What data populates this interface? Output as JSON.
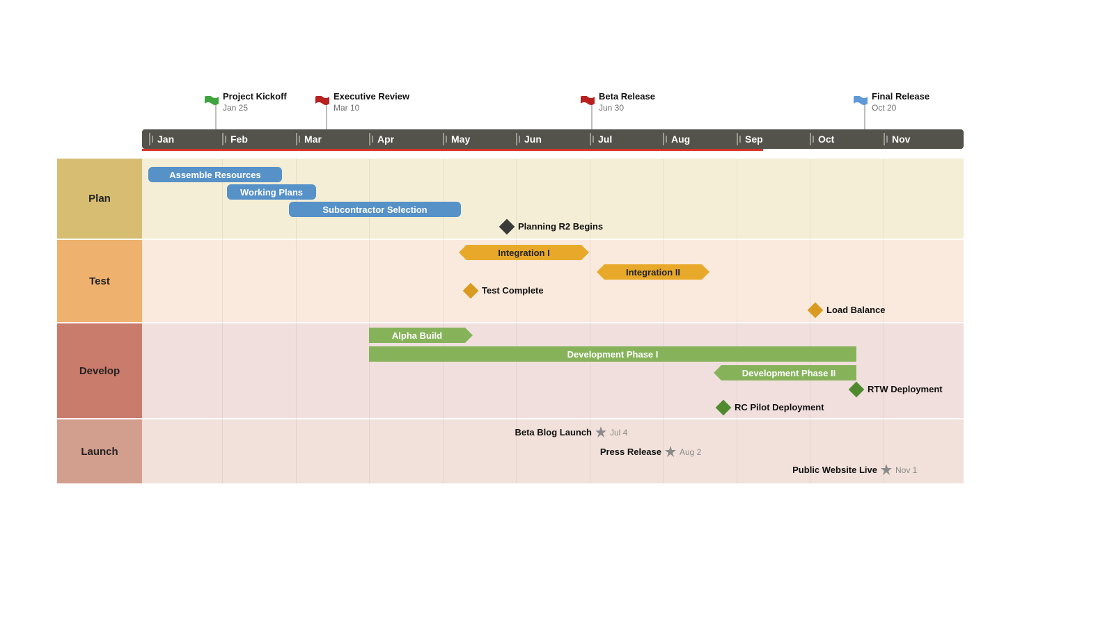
{
  "chart_data": {
    "type": "gantt",
    "title": "",
    "timescale": {
      "months": [
        "Jan",
        "Feb",
        "Mar",
        "Apr",
        "May",
        "Jun",
        "Jul",
        "Aug",
        "Sep",
        "Oct",
        "Nov"
      ],
      "critical_underline_start": "Jan",
      "critical_underline_end": "early Sep"
    },
    "milestones_top": [
      {
        "id": "kickoff",
        "label": "Project Kickoff",
        "date": "Jan 25",
        "flag_color": "#3fa33f"
      },
      {
        "id": "exec",
        "label": "Executive Review",
        "date": "Mar 10",
        "flag_color": "#b8211f"
      },
      {
        "id": "beta",
        "label": "Beta Release",
        "date": "Jun 30",
        "flag_color": "#b8211f"
      },
      {
        "id": "final",
        "label": "Final Release",
        "date": "Oct 20",
        "flag_color": "#5f99d8"
      }
    ],
    "swimlanes": [
      {
        "name": "Plan",
        "label_bg": "#d7bd72",
        "body_bg": "#f5eed6",
        "bars": [
          {
            "label": "Assemble Resources",
            "start": "Jan 1",
            "end": "Feb 22",
            "color": "#5691c8",
            "shape": "rounded"
          },
          {
            "label": "Working Plans",
            "start": "Feb 3",
            "end": "Mar 12",
            "color": "#5691c8",
            "shape": "rounded"
          },
          {
            "label": "Subcontractor Selection",
            "start": "Feb 25",
            "end": "May 8",
            "color": "#5691c8",
            "shape": "rounded"
          }
        ],
        "milestones": [
          {
            "label": "Planning R2 Begins",
            "date": "May 25",
            "marker": "diamond",
            "color": "#3a3a3a"
          }
        ]
      },
      {
        "name": "Test",
        "label_bg": "#eeb16e",
        "body_bg": "#f9eadd",
        "bars": [
          {
            "label": "Integration I",
            "start": "May 8",
            "end": "Jul 1",
            "color": "#e8a92a",
            "shape": "arrow-both",
            "text_color": "#222"
          },
          {
            "label": "Integration II",
            "start": "Jul 4",
            "end": "Aug 20",
            "color": "#e8a92a",
            "shape": "arrow-both",
            "text_color": "#222"
          }
        ],
        "milestones": [
          {
            "label": "Test Complete",
            "date": "May 18",
            "marker": "diamond",
            "color": "#d89a1f"
          },
          {
            "label": "Load Balance",
            "date": "Oct 1",
            "marker": "diamond",
            "color": "#d89a1f"
          }
        ]
      },
      {
        "name": "Develop",
        "label_bg": "#c97b6c",
        "body_bg": "#f1dfde",
        "bars": [
          {
            "label": "Alpha Build",
            "start": "Apr 1",
            "end": "May 12",
            "color": "#86b35a",
            "shape": "arrow-right"
          },
          {
            "label": "Development Phase I",
            "start": "Apr 1",
            "end": "Oct 18",
            "color": "#86b35a",
            "shape": "square"
          },
          {
            "label": "Development Phase II",
            "start": "Aug 25",
            "end": "Oct 18",
            "color": "#86b35a",
            "shape": "arrow-left"
          }
        ],
        "milestones": [
          {
            "label": "RC Pilot Deployment",
            "date": "Aug 28",
            "marker": "diamond",
            "color": "#4f8a2f"
          },
          {
            "label": "RTW Deployment",
            "date": "Oct 18",
            "marker": "diamond",
            "color": "#4f8a2f"
          }
        ]
      },
      {
        "name": "Launch",
        "label_bg": "#d29e8e",
        "body_bg": "#f1e1da",
        "bars": [],
        "milestones": [
          {
            "label": "Beta Blog Launch",
            "date": "Jul 4",
            "marker": "star",
            "color": "#8a8a8a",
            "date_shown": "Jul 4"
          },
          {
            "label": "Press Release",
            "date": "Aug 2",
            "marker": "star",
            "color": "#8a8a8a",
            "date_shown": "Aug 2"
          },
          {
            "label": "Public Website Live",
            "date": "Nov 1",
            "marker": "star",
            "color": "#8a8a8a",
            "date_shown": "Nov 1"
          }
        ]
      }
    ]
  },
  "timeline": {
    "months": {
      "0": "Jan",
      "1": "Feb",
      "2": "Mar",
      "3": "Apr",
      "4": "May",
      "5": "Jun",
      "6": "Jul",
      "7": "Aug",
      "8": "Sep",
      "9": "Oct",
      "10": "Nov"
    }
  },
  "flags": {
    "kickoff": {
      "title": "Project Kickoff",
      "date": "Jan 25"
    },
    "exec": {
      "title": "Executive Review",
      "date": "Mar 10"
    },
    "beta": {
      "title": "Beta Release",
      "date": "Jun 30"
    },
    "final": {
      "title": "Final Release",
      "date": "Oct 20"
    }
  },
  "lanes": {
    "plan": "Plan",
    "test": "Test",
    "develop": "Develop",
    "launch": "Launch"
  },
  "tasks": {
    "plan_assemble": "Assemble Resources",
    "plan_working": "Working Plans",
    "plan_sub": "Subcontractor Selection",
    "plan_r2": "Planning R2 Begins",
    "test_i": "Integration I",
    "test_ii": "Integration II",
    "test_complete": "Test Complete",
    "test_load": "Load Balance",
    "dev_alpha": "Alpha Build",
    "dev_p1": "Development Phase I",
    "dev_p2": "Development Phase II",
    "dev_rc": "RC Pilot Deployment",
    "dev_rtw": "RTW Deployment",
    "launch_blog": "Beta Blog Launch",
    "launch_press": "Press Release",
    "launch_web": "Public Website Live",
    "launch_blog_d": "Jul 4",
    "launch_press_d": "Aug 2",
    "launch_web_d": "Nov 1"
  }
}
